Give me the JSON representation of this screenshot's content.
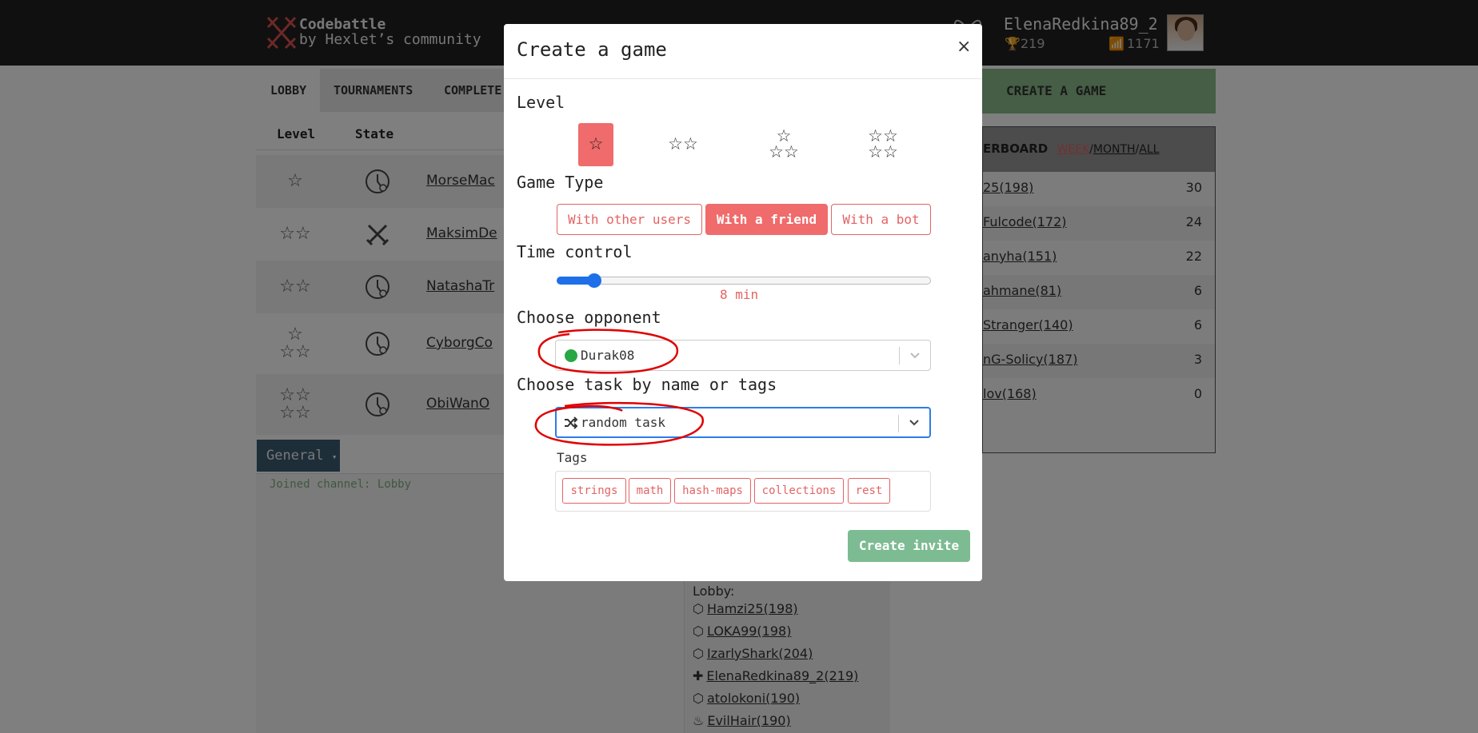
{
  "navbar": {
    "brand_title": "Codebattle",
    "brand_sub": "by Hexlet’s community",
    "user_name": "ElenaRedkina89_2",
    "trophies": "219",
    "rating": "1171"
  },
  "lobby": {
    "tabs": [
      "LOBBY",
      "TOURNAMENTS",
      "COMPLETE"
    ],
    "col_level": "Level",
    "col_state": "State",
    "rows": [
      {
        "level": "☆",
        "player": "MorseMac"
      },
      {
        "level": "☆☆",
        "player": "MaksimDe"
      },
      {
        "level": "☆☆",
        "player": "NatashaTr"
      },
      {
        "level": "☆\n☆☆",
        "player": "CyborgCo"
      },
      {
        "level": "☆☆\n☆☆",
        "player": "ObiWanO"
      }
    ],
    "channel_button": "General",
    "chat_message": "Joined channel: Lobby"
  },
  "right": {
    "create_game": "CREATE A GAME",
    "lb_title": "ERBOARD",
    "lb_week": "WEEK",
    "lb_slash1": "/",
    "lb_month": "MONTH",
    "lb_slash2": "/",
    "lb_all": "ALL",
    "rows": [
      {
        "name": "25(198)",
        "score": "30"
      },
      {
        "name": "Fulcode(172)",
        "score": "24"
      },
      {
        "name": "anyha(151)",
        "score": "22"
      },
      {
        "name": "ahmane(81)",
        "score": "6"
      },
      {
        "name": "Stranger(140)",
        "score": "6"
      },
      {
        "name": "nG-Solicy(187)",
        "score": "3"
      },
      {
        "name": "lov(168)",
        "score": "0"
      }
    ]
  },
  "online": {
    "label": "Lobby:",
    "users": [
      "Hamzi25(198)",
      "LOKA99(198)",
      "IzarlyShark(204)",
      "ElenaRedkina89_2(219)",
      "atolokoni(190)",
      "EvilHair(190)"
    ]
  },
  "modal": {
    "title": "Create a game",
    "close": "×",
    "level_label": "Level",
    "levels": [
      "☆",
      "☆☆",
      "☆\n☆☆",
      "☆☆\n☆☆"
    ],
    "game_type_label": "Game Type",
    "game_types": [
      "With other users",
      "With a friend",
      "With a bot"
    ],
    "time_label": "Time control",
    "time_value": "8 min",
    "time_fraction": 0.1,
    "opponent_label": "Choose opponent",
    "opponent_value": "Durak08",
    "task_label": "Choose task by name or tags",
    "task_value": "random task",
    "tags_label": "Tags",
    "tags": [
      "strings",
      "math",
      "hash-maps",
      "collections",
      "rest"
    ],
    "create_button": "Create invite"
  },
  "colors": {
    "accent_red": "#f06b6b",
    "slider_blue": "#1e6fe8",
    "create_green": "#7dbb92",
    "annotation_red": "#e00000"
  }
}
